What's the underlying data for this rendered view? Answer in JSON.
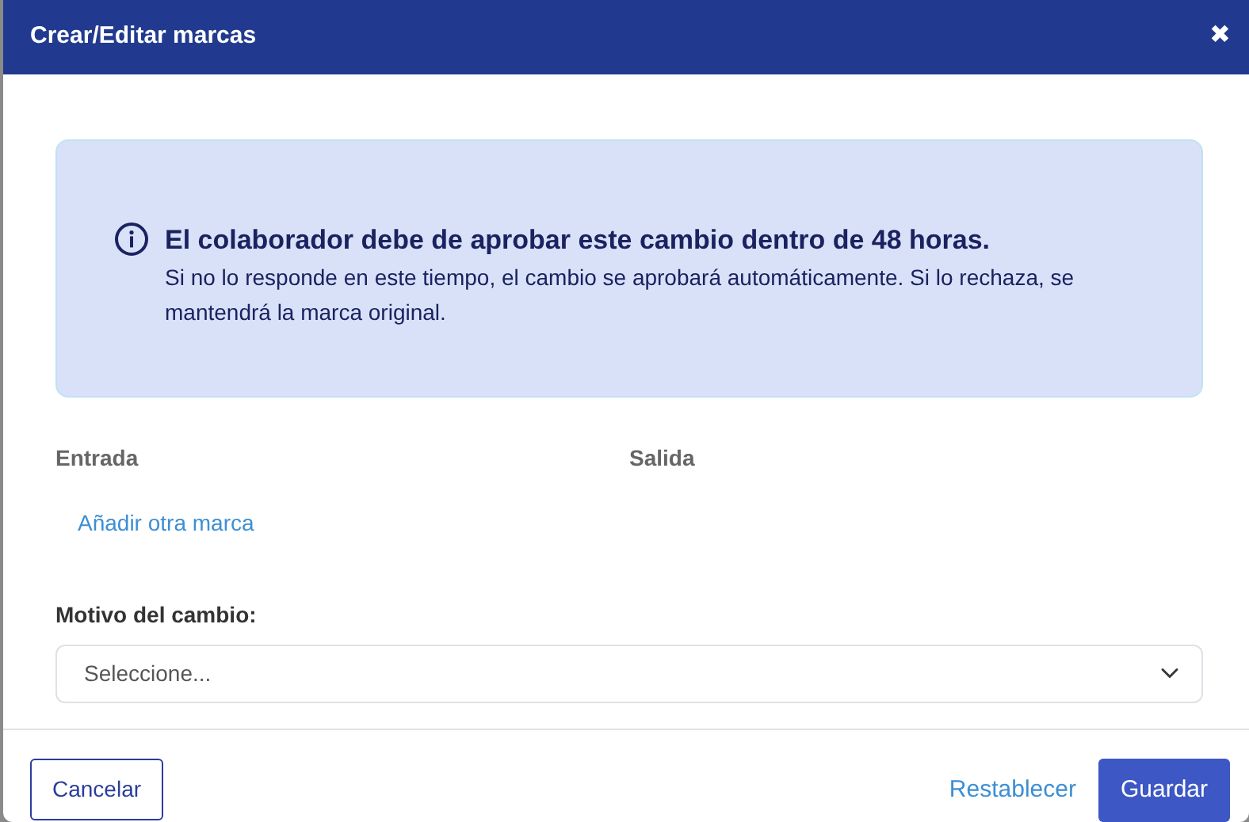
{
  "modal": {
    "title": "Crear/Editar marcas",
    "close": "✖"
  },
  "alert": {
    "heading": "El colaborador debe de aprobar este cambio dentro de 48 horas.",
    "body": "Si no lo responde en este tiempo, el cambio se aprobará automáticamente. Si lo rechaza, se mantendrá la marca original."
  },
  "columns": [
    "Entrada",
    "Salida"
  ],
  "add_link": "Añadir otra marca",
  "reason": {
    "label": "Motivo del cambio:",
    "value": "Seleccione..."
  },
  "footer": {
    "cancel": "Cancelar",
    "reset": "Restablecer",
    "save": "Guardar"
  }
}
